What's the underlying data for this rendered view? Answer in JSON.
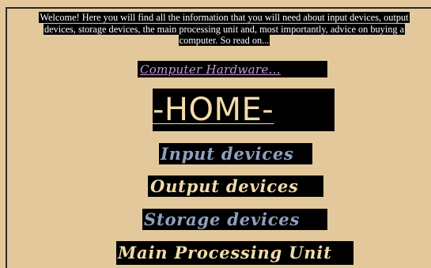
{
  "intro": {
    "line1": "Welcome! Here you will find all the information that you will need about input devices, output",
    "line2": "devices, storage devices, the main processing unit and, most importantly, advice on buying a",
    "line3": "computer. So read on..."
  },
  "links": {
    "computer_hardware": "Computer Hardware...",
    "home": "-HOME-",
    "input_devices": "Input devices",
    "output_devices": "Output devices",
    "storage_devices": "Storage devices",
    "main_processing_unit": "Main Processing Unit"
  },
  "colors": {
    "background": "#e3c89b",
    "highlight": "#000000",
    "link_purple": "#c59ad9",
    "nav_blue": "#8fa1c0",
    "nav_cream": "#f1dba9"
  }
}
